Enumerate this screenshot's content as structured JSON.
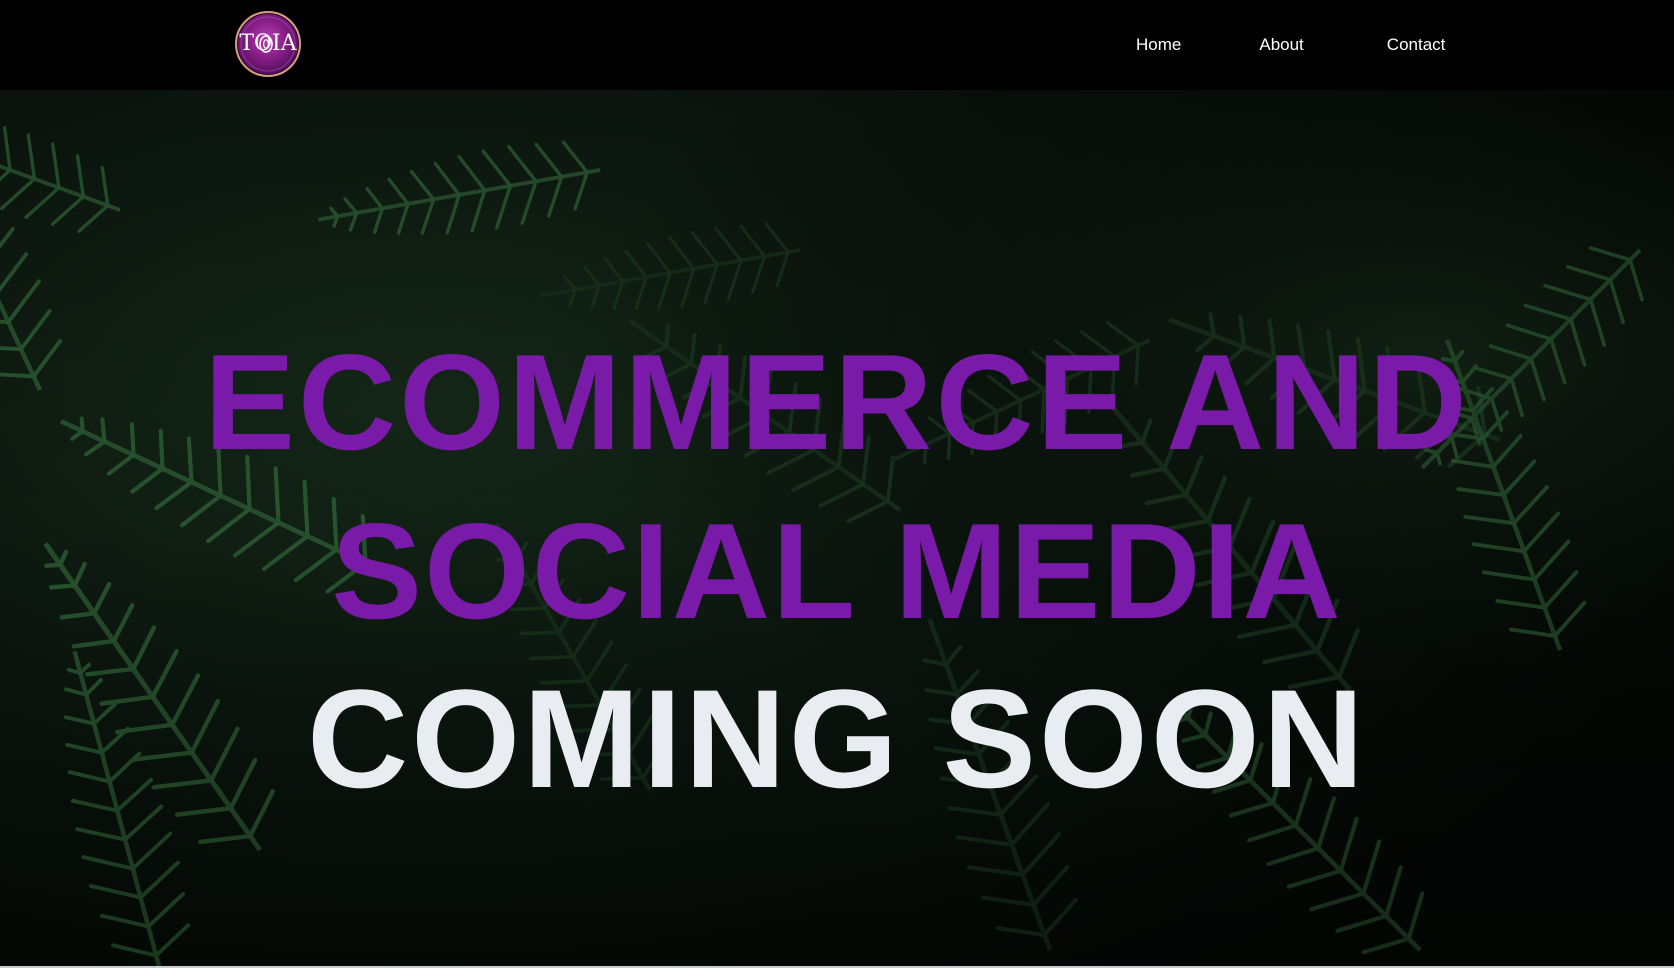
{
  "header": {
    "logo_text": "TOIA",
    "nav": [
      {
        "label": "Home"
      },
      {
        "label": "About"
      },
      {
        "label": "Contact"
      }
    ]
  },
  "hero": {
    "line1": "ECOMMERCE AND",
    "line2": "SOCIAL MEDIA",
    "line3": "COMING SOON",
    "background_image": "dark-green-fern-leaves-photo"
  },
  "colors": {
    "header_background": "#000000",
    "accent_purple": "#7a1aa8",
    "headline_white": "#e9edf1",
    "logo_purple": "#8a1f88",
    "logo_ring": "#d4a27a",
    "fern_green": "#2f6b3a"
  }
}
